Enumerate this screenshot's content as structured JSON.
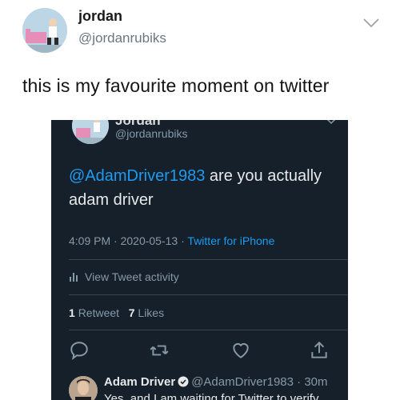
{
  "outer_tweet": {
    "name": "jordan",
    "handle": "@jordanrubiks",
    "text": "this is my favourite moment on twitter"
  },
  "embedded_tweet": {
    "name": "Jordan",
    "handle": "@jordanrubiks",
    "mention": "@AdamDriver1983",
    "body_text": " are you actually adam driver",
    "time": "4:09 PM",
    "date": "2020-05-13",
    "source": "Twitter for iPhone",
    "activity_label": "View Tweet activity",
    "retweets_count": "1",
    "retweets_label": "Retweet",
    "likes_count": "7",
    "likes_label": "Likes"
  },
  "reply": {
    "name": "Adam Driver",
    "handle": "@AdamDriver1983",
    "age": "30m",
    "text": "Yes, and I am waiting for Twitter to verify"
  },
  "colors": {
    "dark_bg": "#15202b",
    "link_blue": "#1d9bf0",
    "muted": "#8899a6"
  },
  "icons": [
    "chevron-down-icon",
    "bar-chart-icon",
    "reply-icon",
    "retweet-icon",
    "like-icon",
    "share-icon",
    "verified-icon"
  ]
}
